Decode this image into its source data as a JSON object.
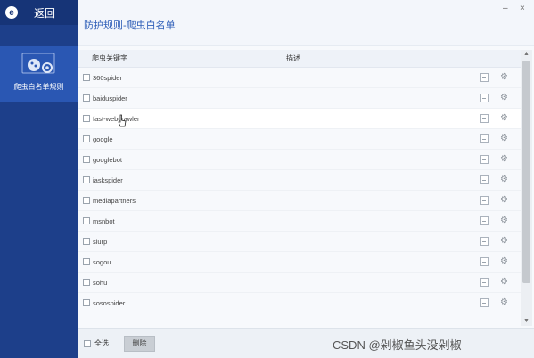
{
  "sidebar": {
    "logo": "e",
    "back_label": "返回",
    "active_item_label": "爬虫白名单规则"
  },
  "window": {
    "title": "防护规则-爬虫白名单",
    "minimize": "–",
    "close": "×"
  },
  "table": {
    "columns": [
      "爬虫关键字",
      "描述"
    ],
    "rows": [
      {
        "name": "360spider"
      },
      {
        "name": "baiduspider"
      },
      {
        "name": "fast-webcrawler"
      },
      {
        "name": "google"
      },
      {
        "name": "googlebot"
      },
      {
        "name": "iaskspider"
      },
      {
        "name": "mediapartners"
      },
      {
        "name": "msnbot"
      },
      {
        "name": "slurp"
      },
      {
        "name": "sogou"
      },
      {
        "name": "sohu"
      },
      {
        "name": "sosospider"
      }
    ]
  },
  "footer": {
    "select_all": "全选",
    "delete": "删除",
    "watermark": "CSDN @剁椒鱼头没剁椒"
  },
  "colors": {
    "sidebar": "#1d3f8a",
    "sidebar_active": "#2a57b3",
    "title": "#2f5fb8"
  }
}
